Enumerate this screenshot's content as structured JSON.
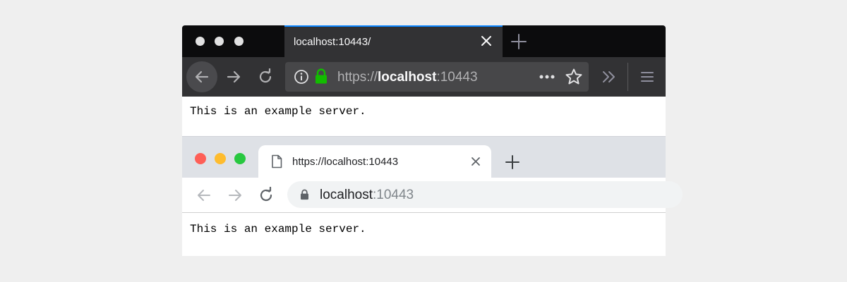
{
  "firefox": {
    "tab_title": "localhost:10443/",
    "url": {
      "scheme": "https://",
      "host": "localhost",
      "port": ":10443"
    },
    "page_text": "This is an example server.",
    "colors": {
      "tab_highlight": "#0a84ff",
      "lock": "#12bc00"
    },
    "icons": [
      "close-icon",
      "plus-icon",
      "back-arrow-icon",
      "forward-arrow-icon",
      "reload-icon",
      "info-icon",
      "lock-icon",
      "more-dots-icon",
      "star-icon",
      "overflow-chevrons-icon",
      "hamburger-menu-icon"
    ]
  },
  "chrome": {
    "tab_title": "https://localhost:10443",
    "url": {
      "host": "localhost",
      "port": ":10443"
    },
    "page_text": "This is an example server.",
    "icons": [
      "page-icon",
      "close-icon",
      "plus-icon",
      "back-arrow-icon",
      "forward-arrow-icon",
      "reload-icon",
      "lock-icon"
    ]
  }
}
